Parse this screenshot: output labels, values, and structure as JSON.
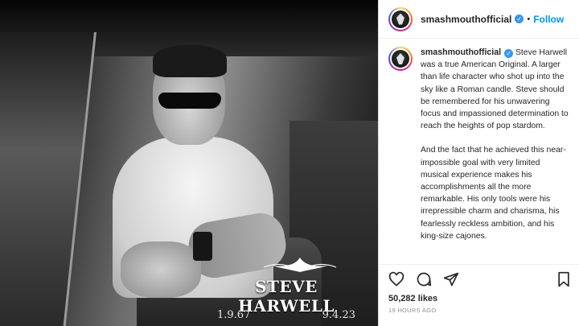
{
  "post": {
    "photo": {
      "name_text": "STEVE HARWELL",
      "date_born": "1.9.67",
      "date_died": "9.4.23"
    },
    "header": {
      "username": "smashmouthofficial",
      "separator": "•",
      "follow_label": "Follow"
    },
    "caption": {
      "username": "smashmouthofficial",
      "paragraph_1": "Steve Harwell was a true American Original. A larger than life character who shot up into the sky like a Roman candle. Steve should be remembered for his unwavering focus and impassioned determination to reach the heights of pop stardom.",
      "paragraph_2": "And the fact that he achieved this near-impossible goal with very limited musical experience makes his accomplishments all the more remarkable. His only tools were his irrepressible charm and charisma, his fearlessly reckless ambition, and his king-size cajones."
    },
    "likes": "50,282 likes",
    "timestamp": "19 HOURS AGO",
    "icons": [
      "heart-icon",
      "comment-icon",
      "share-icon",
      "bookmark-icon",
      "verified-icon"
    ],
    "colors": {
      "accent": "#0095f6",
      "verified": "#3897f0",
      "text": "#262626",
      "muted": "#8e8e8e"
    }
  }
}
